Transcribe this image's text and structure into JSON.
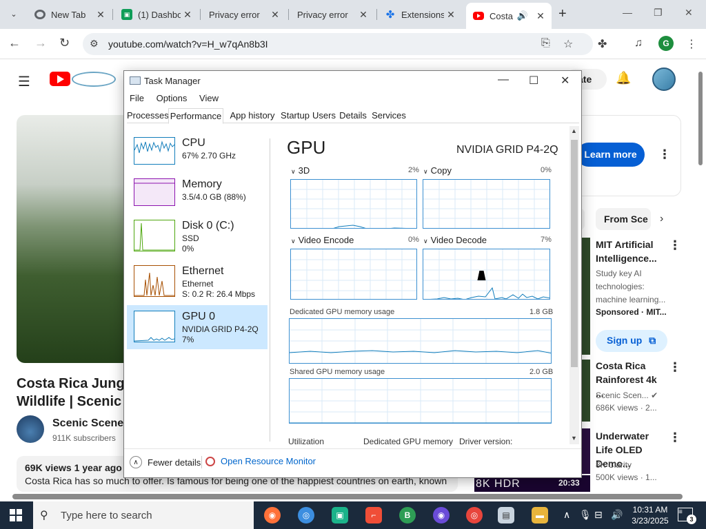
{
  "browser": {
    "tabs": [
      {
        "title": "New Tab",
        "icon": "chrome-icon",
        "color": "#5f6368"
      },
      {
        "title": "(1) Dashbo",
        "icon": "dashboard-icon",
        "color": "#0f9d58"
      },
      {
        "title": "Privacy error",
        "icon": "",
        "color": ""
      },
      {
        "title": "Privacy error",
        "icon": "",
        "color": ""
      },
      {
        "title": "Extensions",
        "icon": "puzzle-icon",
        "color": "#1a73e8"
      },
      {
        "title": "Costa",
        "icon": "youtube-icon",
        "color": "#ff0000"
      }
    ],
    "new_tab_label": "+",
    "url": "youtube.com/watch?v=H_w7qAn8b3I",
    "profile_initial": "G"
  },
  "youtube": {
    "create_label": "ate",
    "ad_button": "Learn more",
    "chips": [
      "s",
      "From Sce"
    ],
    "video_title_line1": "Costa Rica Jungle",
    "video_title_line2": "Wildlife | Scenic R",
    "channel_name": "Scenic Scenes",
    "channel_subs": "911K subscribers",
    "stats": "69K views  1 year ago",
    "description": "Costa Rica has so much to offer. Is famous for being one of the happiest countries on earth, known",
    "recommendations": [
      {
        "title": "MIT Artificial Intelligence...",
        "meta": [
          "Study key AI",
          "technologies:",
          "machine learning..."
        ],
        "sponsor": "Sponsored · MIT..."
      },
      {
        "title": "Costa Rica Rainforest 4k ...",
        "meta": [
          "Scenic Scen...",
          "686K views · 2..."
        ]
      },
      {
        "title": "Underwater Life OLED Demo...",
        "meta": [
          "8K Clarity",
          "500K views · 1..."
        ]
      }
    ],
    "signup_label": "Sign up",
    "hdr_label": "8K HDR",
    "duration": "20:33"
  },
  "task_manager": {
    "title": "Task Manager",
    "menu": [
      "File",
      "Options",
      "View"
    ],
    "tabs": [
      "Processes",
      "Performance",
      "App history",
      "Startup",
      "Users",
      "Details",
      "Services"
    ],
    "active_tab": "Performance",
    "sidebar": [
      {
        "name": "CPU",
        "line1": "67%  2.70 GHz",
        "line2": "",
        "color": "#117dbb"
      },
      {
        "name": "Memory",
        "line1": "3.5/4.0 GB (88%)",
        "line2": "",
        "color": "#8b12ae"
      },
      {
        "name": "Disk 0 (C:)",
        "line1": "SSD",
        "line2": "0%",
        "color": "#4da60c"
      },
      {
        "name": "Ethernet",
        "line1": "Ethernet",
        "line2": "S: 0.2  R: 26.4 Mbps",
        "color": "#a74f01"
      },
      {
        "name": "GPU 0",
        "line1": "NVIDIA GRID P4-2Q",
        "line2": "7%",
        "color": "#117dbb"
      }
    ],
    "gpu": {
      "title": "GPU",
      "name": "NVIDIA GRID P4-2Q",
      "engines": [
        {
          "label": "3D",
          "pct": "2%"
        },
        {
          "label": "Copy",
          "pct": "0%"
        },
        {
          "label": "Video Encode",
          "pct": "0%"
        },
        {
          "label": "Video Decode",
          "pct": "7%"
        }
      ],
      "dedicated_label": "Dedicated GPU memory usage",
      "dedicated_max": "1.8 GB",
      "shared_label": "Shared GPU memory usage",
      "shared_max": "2.0 GB",
      "footer_labels": [
        "Utilization",
        "Dedicated GPU memory",
        "Driver version:"
      ]
    },
    "fewer_details": "Fewer details",
    "resource_monitor": "Open Resource Monitor"
  },
  "taskbar": {
    "search_placeholder": "Type here to search",
    "time": "10:31 AM",
    "date": "3/23/2025",
    "notifications": "3"
  }
}
